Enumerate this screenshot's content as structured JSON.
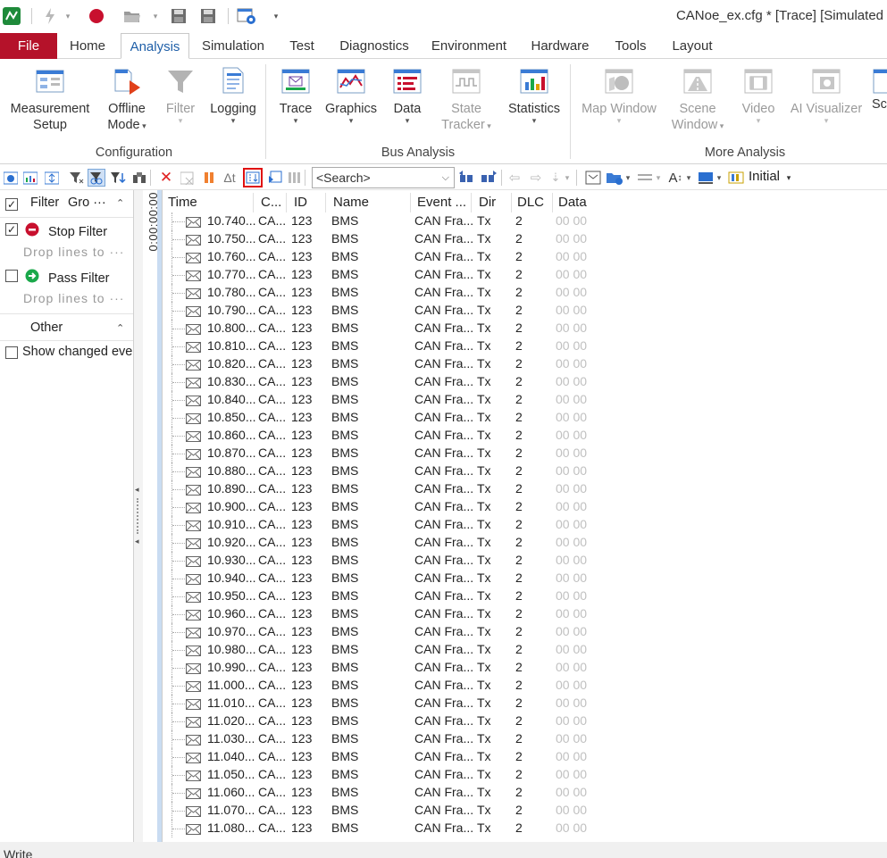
{
  "window": {
    "title": "CANoe_ex.cfg * [Trace] [Simulated"
  },
  "menu_tabs": [
    {
      "label": "File"
    },
    {
      "label": "Home"
    },
    {
      "label": "Analysis"
    },
    {
      "label": "Simulation"
    },
    {
      "label": "Test"
    },
    {
      "label": "Diagnostics"
    },
    {
      "label": "Environment"
    },
    {
      "label": "Hardware"
    },
    {
      "label": "Tools"
    },
    {
      "label": "Layout"
    }
  ],
  "ribbon": {
    "buttons": {
      "measurement_setup": {
        "line1": "Measurement",
        "line2": "Setup"
      },
      "offline_mode": {
        "line1": "Offline",
        "line2": "Mode"
      },
      "filter": {
        "line1": "Filter"
      },
      "logging": {
        "line1": "Logging"
      },
      "trace": {
        "line1": "Trace"
      },
      "graphics": {
        "line1": "Graphics"
      },
      "data": {
        "line1": "Data"
      },
      "state_tracker": {
        "line1": "State",
        "line2": "Tracker"
      },
      "statistics": {
        "line1": "Statistics"
      },
      "map_window": {
        "line1": "Map Window"
      },
      "scene_window": {
        "line1": "Scene",
        "line2": "Window"
      },
      "video": {
        "line1": "Video"
      },
      "ai_visualizer": {
        "line1": "AI Visualizer"
      },
      "cut_off": {
        "line1": "Sc"
      }
    },
    "groups": {
      "configuration": "Configuration",
      "bus_analysis": "Bus Analysis",
      "more_analysis": "More Analysis"
    }
  },
  "toolbar": {
    "search_placeholder": "<Search>",
    "layout_label": "Initial"
  },
  "filter_panel": {
    "header_label": "Filter",
    "header_group": "Gro ···",
    "stop_filter": {
      "label": "Stop Filter",
      "checked": true,
      "hint": "Drop lines to ···"
    },
    "pass_filter": {
      "label": "Pass Filter",
      "checked": false,
      "hint": "Drop lines to ···"
    },
    "other_header": "Other",
    "show_changed": {
      "label": "Show changed eve",
      "checked": false
    }
  },
  "time_axis": {
    "label": "0:00:00:00"
  },
  "trace": {
    "columns": [
      "Time",
      "C...",
      "ID",
      "Name",
      "Event ...",
      "Dir",
      "DLC",
      "Data"
    ],
    "rows": [
      {
        "time": "10.740...",
        "ch": "CA...",
        "id": "123",
        "name": "BMS",
        "event": "CAN Fra...",
        "dir": "Tx",
        "dlc": "2",
        "data": "00  00"
      },
      {
        "time": "10.750...",
        "ch": "CA...",
        "id": "123",
        "name": "BMS",
        "event": "CAN Fra...",
        "dir": "Tx",
        "dlc": "2",
        "data": "00  00"
      },
      {
        "time": "10.760...",
        "ch": "CA...",
        "id": "123",
        "name": "BMS",
        "event": "CAN Fra...",
        "dir": "Tx",
        "dlc": "2",
        "data": "00  00"
      },
      {
        "time": "10.770...",
        "ch": "CA...",
        "id": "123",
        "name": "BMS",
        "event": "CAN Fra...",
        "dir": "Tx",
        "dlc": "2",
        "data": "00  00"
      },
      {
        "time": "10.780...",
        "ch": "CA...",
        "id": "123",
        "name": "BMS",
        "event": "CAN Fra...",
        "dir": "Tx",
        "dlc": "2",
        "data": "00  00"
      },
      {
        "time": "10.790...",
        "ch": "CA...",
        "id": "123",
        "name": "BMS",
        "event": "CAN Fra...",
        "dir": "Tx",
        "dlc": "2",
        "data": "00  00"
      },
      {
        "time": "10.800...",
        "ch": "CA...",
        "id": "123",
        "name": "BMS",
        "event": "CAN Fra...",
        "dir": "Tx",
        "dlc": "2",
        "data": "00  00"
      },
      {
        "time": "10.810...",
        "ch": "CA...",
        "id": "123",
        "name": "BMS",
        "event": "CAN Fra...",
        "dir": "Tx",
        "dlc": "2",
        "data": "00  00"
      },
      {
        "time": "10.820...",
        "ch": "CA...",
        "id": "123",
        "name": "BMS",
        "event": "CAN Fra...",
        "dir": "Tx",
        "dlc": "2",
        "data": "00  00"
      },
      {
        "time": "10.830...",
        "ch": "CA...",
        "id": "123",
        "name": "BMS",
        "event": "CAN Fra...",
        "dir": "Tx",
        "dlc": "2",
        "data": "00  00"
      },
      {
        "time": "10.840...",
        "ch": "CA...",
        "id": "123",
        "name": "BMS",
        "event": "CAN Fra...",
        "dir": "Tx",
        "dlc": "2",
        "data": "00  00"
      },
      {
        "time": "10.850...",
        "ch": "CA...",
        "id": "123",
        "name": "BMS",
        "event": "CAN Fra...",
        "dir": "Tx",
        "dlc": "2",
        "data": "00  00"
      },
      {
        "time": "10.860...",
        "ch": "CA...",
        "id": "123",
        "name": "BMS",
        "event": "CAN Fra...",
        "dir": "Tx",
        "dlc": "2",
        "data": "00  00"
      },
      {
        "time": "10.870...",
        "ch": "CA...",
        "id": "123",
        "name": "BMS",
        "event": "CAN Fra...",
        "dir": "Tx",
        "dlc": "2",
        "data": "00  00"
      },
      {
        "time": "10.880...",
        "ch": "CA...",
        "id": "123",
        "name": "BMS",
        "event": "CAN Fra...",
        "dir": "Tx",
        "dlc": "2",
        "data": "00  00"
      },
      {
        "time": "10.890...",
        "ch": "CA...",
        "id": "123",
        "name": "BMS",
        "event": "CAN Fra...",
        "dir": "Tx",
        "dlc": "2",
        "data": "00  00"
      },
      {
        "time": "10.900...",
        "ch": "CA...",
        "id": "123",
        "name": "BMS",
        "event": "CAN Fra...",
        "dir": "Tx",
        "dlc": "2",
        "data": "00  00"
      },
      {
        "time": "10.910...",
        "ch": "CA...",
        "id": "123",
        "name": "BMS",
        "event": "CAN Fra...",
        "dir": "Tx",
        "dlc": "2",
        "data": "00  00"
      },
      {
        "time": "10.920...",
        "ch": "CA...",
        "id": "123",
        "name": "BMS",
        "event": "CAN Fra...",
        "dir": "Tx",
        "dlc": "2",
        "data": "00  00"
      },
      {
        "time": "10.930...",
        "ch": "CA...",
        "id": "123",
        "name": "BMS",
        "event": "CAN Fra...",
        "dir": "Tx",
        "dlc": "2",
        "data": "00  00"
      },
      {
        "time": "10.940...",
        "ch": "CA...",
        "id": "123",
        "name": "BMS",
        "event": "CAN Fra...",
        "dir": "Tx",
        "dlc": "2",
        "data": "00  00"
      },
      {
        "time": "10.950...",
        "ch": "CA...",
        "id": "123",
        "name": "BMS",
        "event": "CAN Fra...",
        "dir": "Tx",
        "dlc": "2",
        "data": "00  00"
      },
      {
        "time": "10.960...",
        "ch": "CA...",
        "id": "123",
        "name": "BMS",
        "event": "CAN Fra...",
        "dir": "Tx",
        "dlc": "2",
        "data": "00  00"
      },
      {
        "time": "10.970...",
        "ch": "CA...",
        "id": "123",
        "name": "BMS",
        "event": "CAN Fra...",
        "dir": "Tx",
        "dlc": "2",
        "data": "00  00"
      },
      {
        "time": "10.980...",
        "ch": "CA...",
        "id": "123",
        "name": "BMS",
        "event": "CAN Fra...",
        "dir": "Tx",
        "dlc": "2",
        "data": "00  00"
      },
      {
        "time": "10.990...",
        "ch": "CA...",
        "id": "123",
        "name": "BMS",
        "event": "CAN Fra...",
        "dir": "Tx",
        "dlc": "2",
        "data": "00  00"
      },
      {
        "time": "11.000...",
        "ch": "CA...",
        "id": "123",
        "name": "BMS",
        "event": "CAN Fra...",
        "dir": "Tx",
        "dlc": "2",
        "data": "00  00"
      },
      {
        "time": "11.010...",
        "ch": "CA...",
        "id": "123",
        "name": "BMS",
        "event": "CAN Fra...",
        "dir": "Tx",
        "dlc": "2",
        "data": "00  00"
      },
      {
        "time": "11.020...",
        "ch": "CA...",
        "id": "123",
        "name": "BMS",
        "event": "CAN Fra...",
        "dir": "Tx",
        "dlc": "2",
        "data": "00  00"
      },
      {
        "time": "11.030...",
        "ch": "CA...",
        "id": "123",
        "name": "BMS",
        "event": "CAN Fra...",
        "dir": "Tx",
        "dlc": "2",
        "data": "00  00"
      },
      {
        "time": "11.040...",
        "ch": "CA...",
        "id": "123",
        "name": "BMS",
        "event": "CAN Fra...",
        "dir": "Tx",
        "dlc": "2",
        "data": "00  00"
      },
      {
        "time": "11.050...",
        "ch": "CA...",
        "id": "123",
        "name": "BMS",
        "event": "CAN Fra...",
        "dir": "Tx",
        "dlc": "2",
        "data": "00  00"
      },
      {
        "time": "11.060...",
        "ch": "CA...",
        "id": "123",
        "name": "BMS",
        "event": "CAN Fra...",
        "dir": "Tx",
        "dlc": "2",
        "data": "00  00"
      },
      {
        "time": "11.070...",
        "ch": "CA...",
        "id": "123",
        "name": "BMS",
        "event": "CAN Fra...",
        "dir": "Tx",
        "dlc": "2",
        "data": "00  00"
      },
      {
        "time": "11.080...",
        "ch": "CA...",
        "id": "123",
        "name": "BMS",
        "event": "CAN Fra...",
        "dir": "Tx",
        "dlc": "2",
        "data": "00  00"
      }
    ]
  },
  "status_bar": {
    "text": "Write"
  },
  "colors": {
    "file_tab": "#b5122a",
    "accent_blue": "#1f5fa8",
    "highlight_red": "#e01010"
  }
}
